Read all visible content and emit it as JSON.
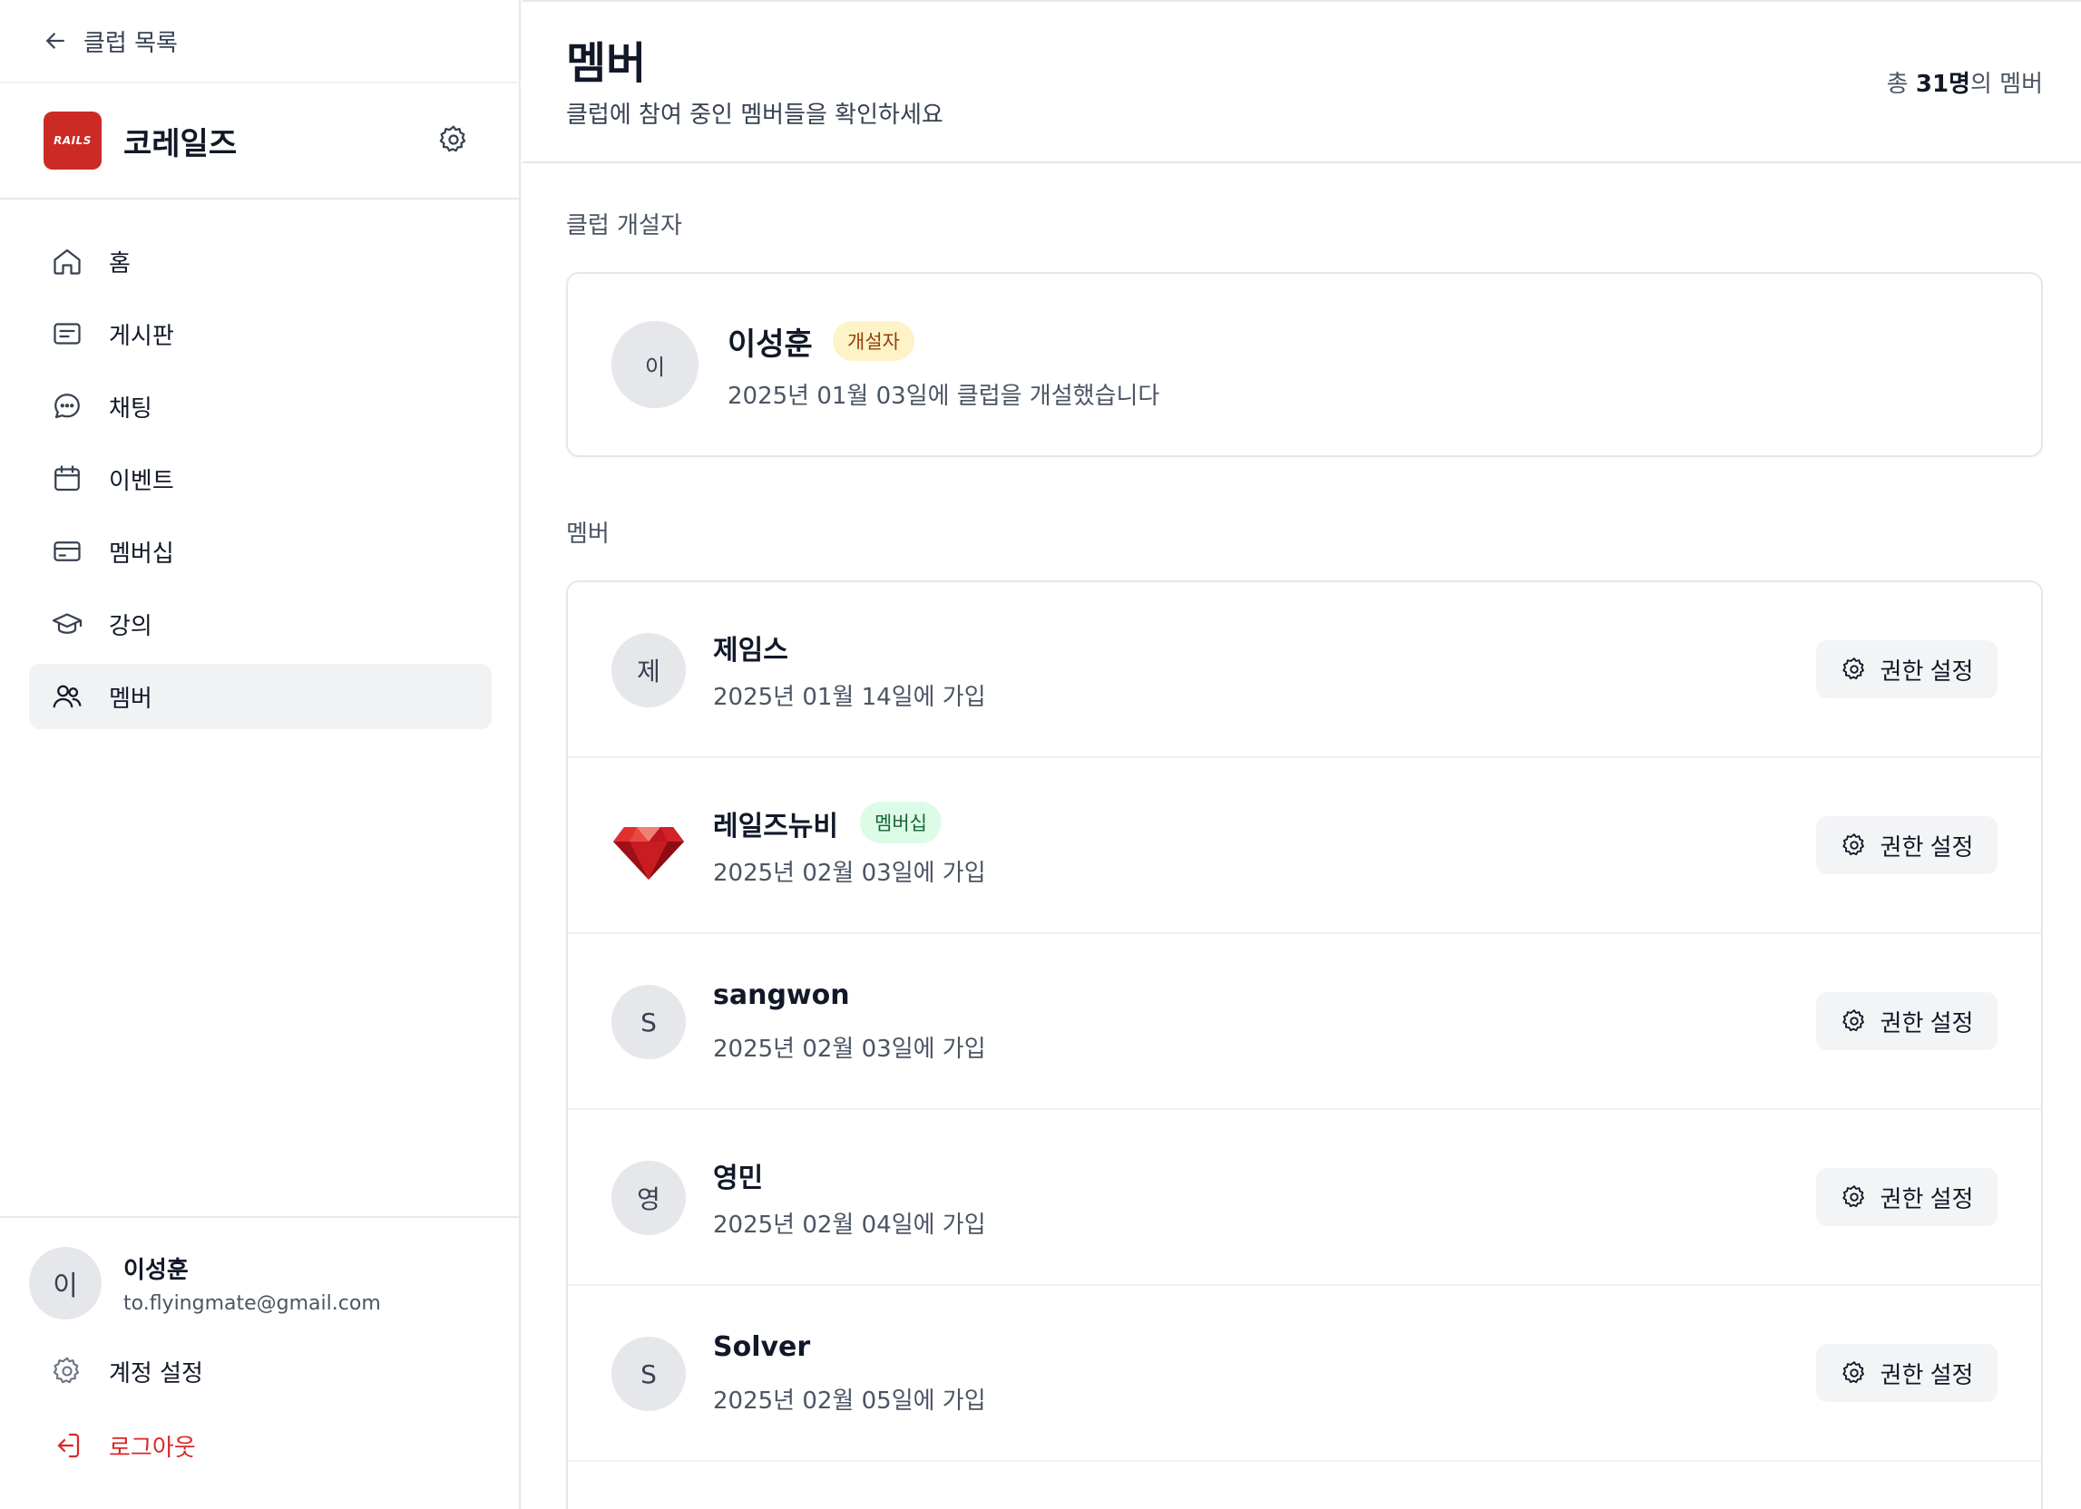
{
  "sidebar": {
    "back_label": "클럽 목록",
    "club": {
      "name": "코레일즈",
      "logo_text": "RAILS",
      "logo_color": "#cc2a24"
    },
    "nav": [
      {
        "label": "홈",
        "icon": "home-icon"
      },
      {
        "label": "게시판",
        "icon": "board-icon"
      },
      {
        "label": "채팅",
        "icon": "chat-icon"
      },
      {
        "label": "이벤트",
        "icon": "calendar-icon"
      },
      {
        "label": "멤버십",
        "icon": "credit-card-icon"
      },
      {
        "label": "강의",
        "icon": "graduation-cap-icon"
      },
      {
        "label": "멤버",
        "icon": "users-icon",
        "active": true
      }
    ],
    "user": {
      "avatar": "이",
      "name": "이성훈",
      "email": "to.flyingmate@gmail.com"
    },
    "account_settings_label": "계정 설정",
    "logout_label": "로그아웃",
    "logout_color": "#dc2626"
  },
  "main": {
    "title": "멤버",
    "subtitle": "클럽에 참여 중인 멤버들을 확인하세요",
    "total": {
      "prefix": "총 ",
      "count": "31명",
      "suffix": "의 멤버"
    },
    "founder_section_label": "클럽 개설자",
    "founder": {
      "avatar": "이",
      "name": "이성훈",
      "badge": "개설자",
      "date": "2025년 01월 03일에 클럽을 개설했습니다"
    },
    "members_section_label": "멤버",
    "permission_label": "권한 설정",
    "members": [
      {
        "avatar": "제",
        "name": "제임스",
        "date": "2025년 01월 14일에 가입"
      },
      {
        "avatar": "",
        "avatar_icon": "ruby-gem-icon",
        "name": "레일즈뉴비",
        "badge": "멤버십",
        "date": "2025년 02월 03일에 가입"
      },
      {
        "avatar": "S",
        "name": "sangwon",
        "date": "2025년 02월 03일에 가입"
      },
      {
        "avatar": "영",
        "name": "영민",
        "date": "2025년 02월 04일에 가입"
      },
      {
        "avatar": "S",
        "name": "Solver",
        "date": "2025년 02월 05일에 가입"
      }
    ]
  }
}
